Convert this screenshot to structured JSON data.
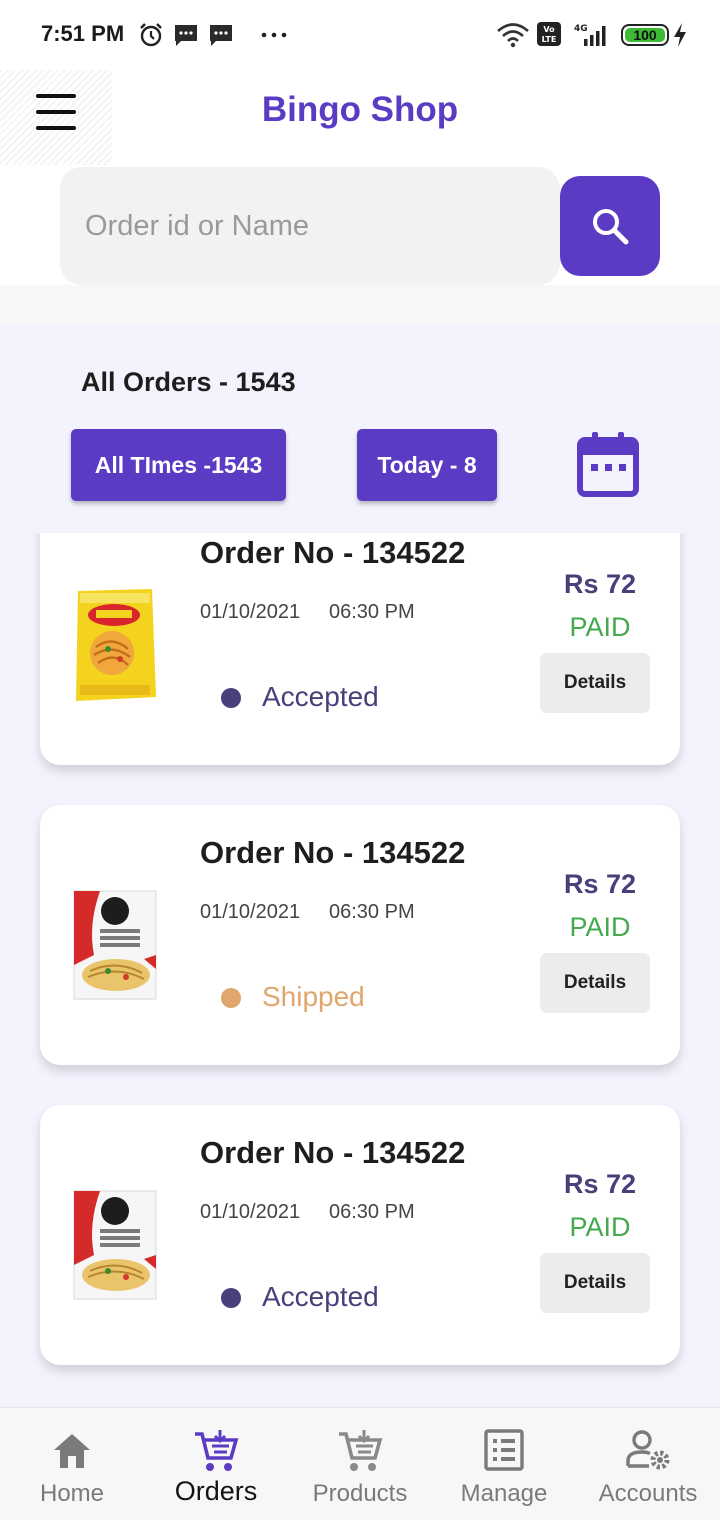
{
  "status_bar": {
    "time": "7:51 PM",
    "icons": [
      "alarm-icon",
      "message-icon",
      "message-icon",
      "more-dots-icon",
      "wifi-icon",
      "volte-icon",
      "signal-4g-icon",
      "battery-icon",
      "charging-icon"
    ],
    "volte_label": "Vo\nLTE",
    "network_label": "4G",
    "battery": "100",
    "battery_level": 1.0,
    "battery_color": "#3dbb34"
  },
  "header": {
    "menu_icon": "hamburger-menu-icon",
    "title": "Bingo Shop"
  },
  "search": {
    "placeholder": "Order id or Name",
    "value": "",
    "button_icon": "search-icon"
  },
  "orders": {
    "title": "All Orders - 1543",
    "filters": [
      {
        "label": "All TImes -1543"
      },
      {
        "label": "Today - 8"
      }
    ],
    "calendar_icon": "calendar-icon",
    "details_label": "Details",
    "items": [
      {
        "order_no": "Order No - 134522",
        "date": "01/10/2021",
        "time": "06:30 PM",
        "status": "Accepted",
        "status_color": "#47407a",
        "price": "Rs 72",
        "payment": "PAID",
        "product_image": "maggi-noodles-pack"
      },
      {
        "order_no": "Order No - 134522",
        "date": "01/10/2021",
        "time": "06:30 PM",
        "status": "Shipped",
        "status_color": "#e0a66b",
        "price": "Rs 72",
        "payment": "PAID",
        "product_image": "chings-veg-hakka-noodles-pack"
      },
      {
        "order_no": "Order No - 134522",
        "date": "01/10/2021",
        "time": "06:30 PM",
        "status": "Accepted",
        "status_color": "#47407a",
        "price": "Rs 72",
        "payment": "PAID",
        "product_image": "chings-veg-hakka-noodles-pack"
      }
    ]
  },
  "bottom_nav": [
    {
      "label": "Home",
      "icon": "home-icon",
      "active": false
    },
    {
      "label": "Orders",
      "icon": "cart-icon",
      "active": true
    },
    {
      "label": "Products",
      "icon": "cart-icon",
      "active": false
    },
    {
      "label": "Manage",
      "icon": "list-document-icon",
      "active": false
    },
    {
      "label": "Accounts",
      "icon": "user-settings-icon",
      "active": false
    }
  ],
  "colors": {
    "primary": "#5b3bc4",
    "price": "#47407a",
    "paid": "#44a94c",
    "accepted": "#47407a",
    "shipped": "#e0a66b",
    "background": "#f3f3fe"
  }
}
